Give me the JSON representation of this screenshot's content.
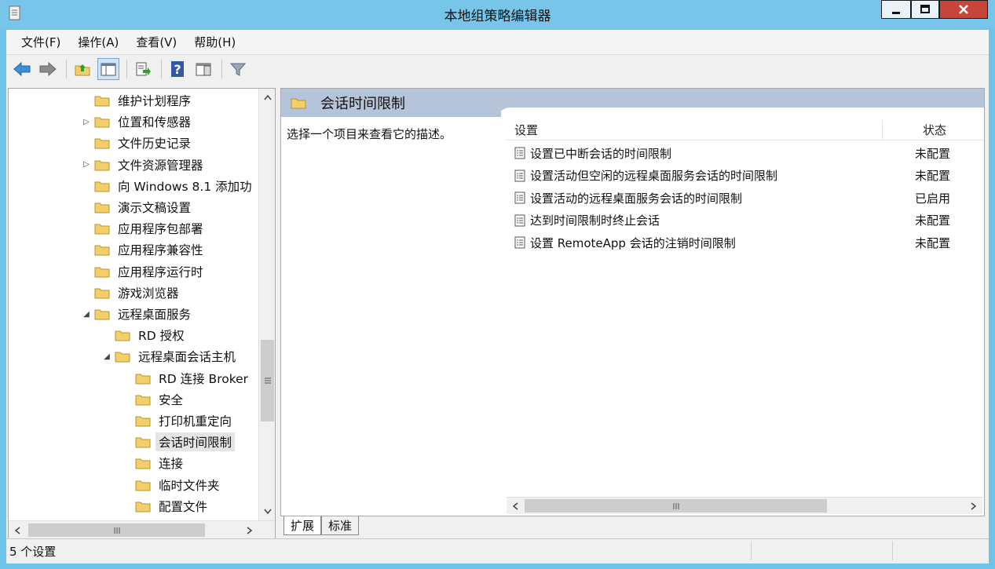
{
  "window": {
    "title": "本地组策略编辑器"
  },
  "menubar": [
    {
      "label": "文件(F)"
    },
    {
      "label": "操作(A)"
    },
    {
      "label": "查看(V)"
    },
    {
      "label": "帮助(H)"
    }
  ],
  "toolbar": {
    "icons": [
      "back-arrow-icon",
      "forward-arrow-icon",
      "up-folder-icon",
      "show-hide-tree-icon",
      "export-list-icon",
      "help-icon",
      "properties-pane-icon",
      "filter-icon"
    ]
  },
  "tree": {
    "items": [
      {
        "label": "维护计划程序",
        "level": 0,
        "expander": ""
      },
      {
        "label": "位置和传感器",
        "level": 0,
        "expander": "▷"
      },
      {
        "label": "文件历史记录",
        "level": 0,
        "expander": ""
      },
      {
        "label": "文件资源管理器",
        "level": 0,
        "expander": "▷"
      },
      {
        "label": "向 Windows 8.1 添加功",
        "level": 0,
        "expander": ""
      },
      {
        "label": "演示文稿设置",
        "level": 0,
        "expander": ""
      },
      {
        "label": "应用程序包部署",
        "level": 0,
        "expander": ""
      },
      {
        "label": "应用程序兼容性",
        "level": 0,
        "expander": ""
      },
      {
        "label": "应用程序运行时",
        "level": 0,
        "expander": ""
      },
      {
        "label": "游戏浏览器",
        "level": 0,
        "expander": ""
      },
      {
        "label": "远程桌面服务",
        "level": 0,
        "expander": "◢"
      },
      {
        "label": "RD 授权",
        "level": 1,
        "expander": ""
      },
      {
        "label": "远程桌面会话主机",
        "level": 1,
        "expander": "◢"
      },
      {
        "label": "RD 连接 Broker",
        "level": 2,
        "expander": ""
      },
      {
        "label": "安全",
        "level": 2,
        "expander": ""
      },
      {
        "label": "打印机重定向",
        "level": 2,
        "expander": ""
      },
      {
        "label": "会话时间限制",
        "level": 2,
        "expander": "",
        "selected": true
      },
      {
        "label": "连接",
        "level": 2,
        "expander": ""
      },
      {
        "label": "临时文件夹",
        "level": 2,
        "expander": ""
      },
      {
        "label": "配置文件",
        "level": 2,
        "expander": ""
      }
    ]
  },
  "details": {
    "header_title": "会话时间限制",
    "description": "选择一个项目来查看它的描述。",
    "columns": {
      "setting": "设置",
      "state": "状态"
    },
    "rows": [
      {
        "setting": "设置已中断会话的时间限制",
        "state": "未配置"
      },
      {
        "setting": "设置活动但空闲的远程桌面服务会话的时间限制",
        "state": "未配置"
      },
      {
        "setting": "设置活动的远程桌面服务会话的时间限制",
        "state": "已启用"
      },
      {
        "setting": "达到时间限制时终止会话",
        "state": "未配置"
      },
      {
        "setting": "设置 RemoteApp 会话的注销时间限制",
        "state": "未配置"
      }
    ]
  },
  "tabs": {
    "extended": "扩展",
    "standard": "标准"
  },
  "statusbar": {
    "text": "5 个设置"
  },
  "colors": {
    "titlebar": "#77c6ea",
    "close_button": "#c8453b",
    "header_band": "#b5c4d9",
    "folder": "#f2cf6a"
  }
}
